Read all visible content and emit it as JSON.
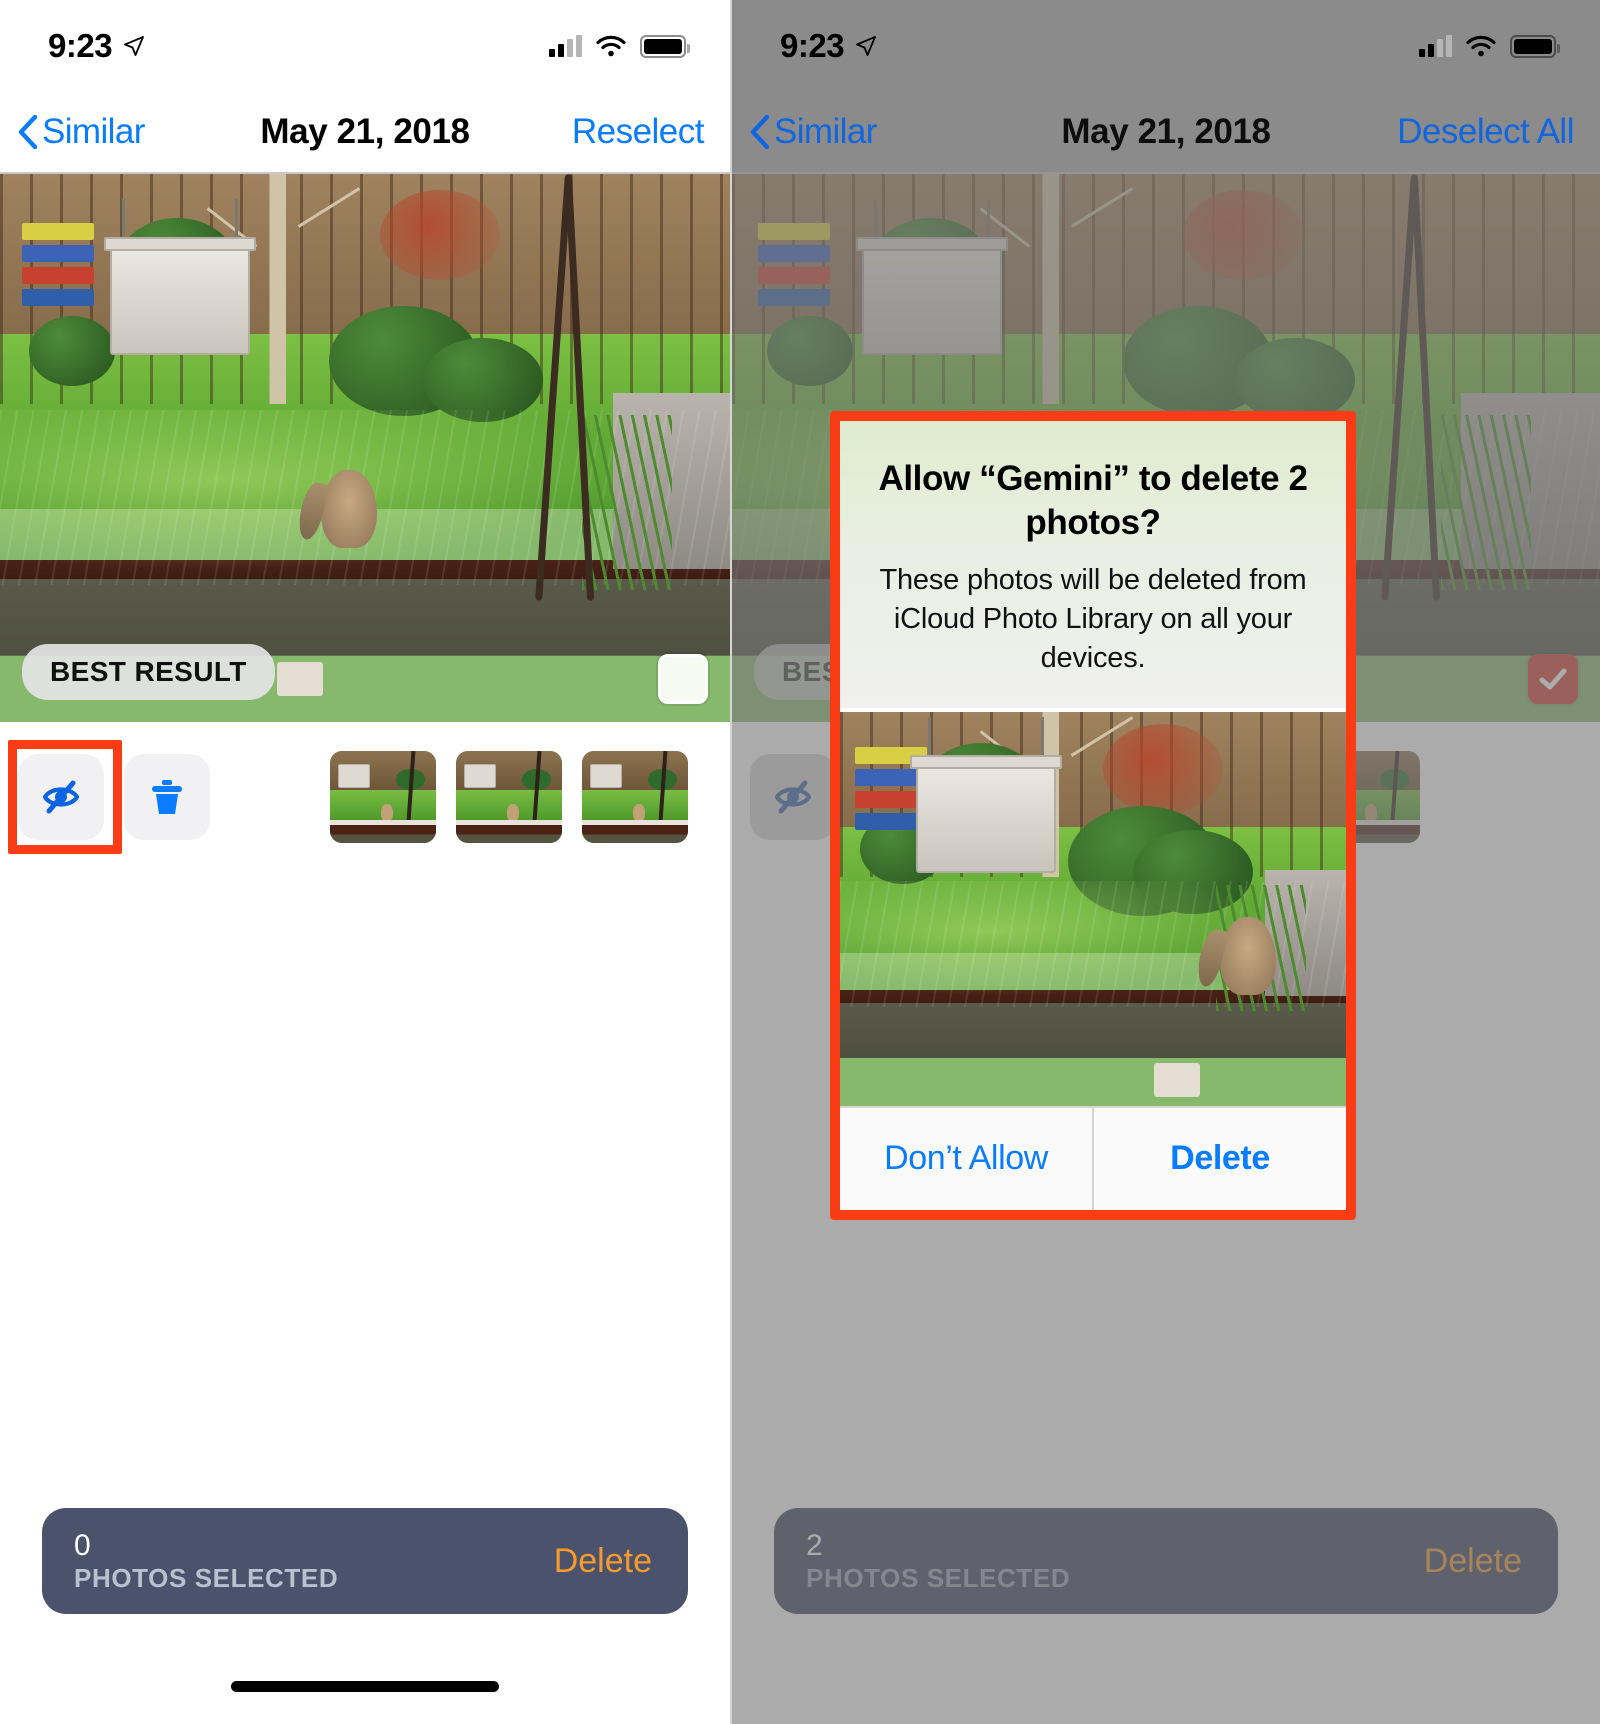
{
  "app": {
    "name": "Gemini"
  },
  "left_screen": {
    "status_bar": {
      "time": "9:23",
      "location_icon": "location-arrow-icon",
      "cellular_icon": "signal-bars-icon",
      "wifi_icon": "wifi-icon",
      "battery_icon": "battery-full-icon"
    },
    "nav_bar": {
      "back_label": "Similar",
      "back_icon": "chevron-left-icon",
      "title": "May 21, 2018",
      "action_label": "Reselect"
    },
    "photo": {
      "badge": "BEST RESULT",
      "checkbox_state": "unchecked"
    },
    "toolbar": {
      "hide_icon": "eye-slash-icon",
      "delete_icon": "trash-icon",
      "highlight_color": "#fa3c16",
      "thumbnail_count": 3
    },
    "selection_bar": {
      "count": "0",
      "caption": "PHOTOS SELECTED",
      "action": "Delete"
    },
    "home_indicator": true
  },
  "right_screen": {
    "status_bar": {
      "time": "9:23",
      "location_icon": "location-arrow-icon",
      "cellular_icon": "signal-bars-icon",
      "wifi_icon": "wifi-icon",
      "battery_icon": "battery-full-icon"
    },
    "nav_bar": {
      "back_label": "Similar",
      "back_icon": "chevron-left-icon",
      "title": "May 21, 2018",
      "action_label": "Deselect All"
    },
    "photo": {
      "badge": "BEST RESULT",
      "checkbox_state": "checked",
      "checkbox_color": "#cf3a31"
    },
    "toolbar": {
      "hide_icon": "eye-slash-icon",
      "delete_icon": "trash-icon",
      "thumbnail_count": 3
    },
    "alert": {
      "title": "Allow “Gemini” to delete 2 photos?",
      "message": "These photos will be deleted from iCloud Photo Library on all your devices.",
      "deny_label": "Don’t Allow",
      "confirm_label": "Delete",
      "highlight_color": "#fa3c16"
    },
    "selection_bar": {
      "count": "2",
      "caption": "PHOTOS SELECTED",
      "action": "Delete"
    }
  }
}
